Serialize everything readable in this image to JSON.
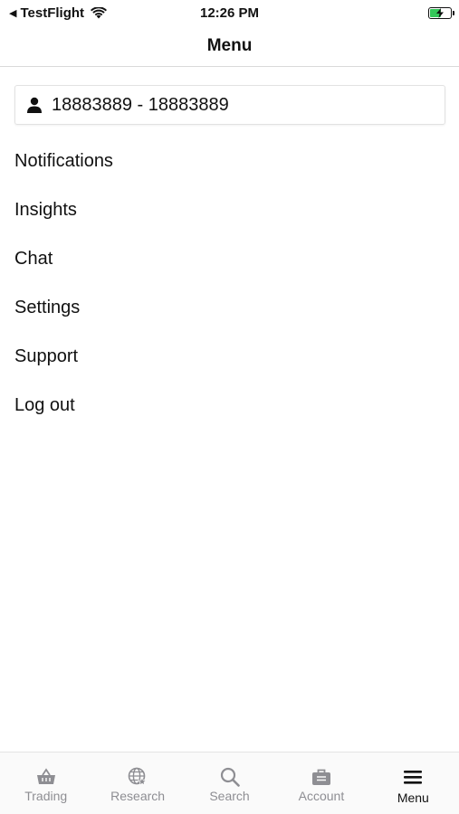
{
  "status_bar": {
    "back_label": "TestFlight",
    "time": "12:26 PM",
    "battery_color": "#34c759"
  },
  "header": {
    "title": "Menu"
  },
  "account": {
    "label": "18883889 - 18883889",
    "icon": "user-icon"
  },
  "menu": {
    "items": [
      {
        "label": "Notifications"
      },
      {
        "label": "Insights"
      },
      {
        "label": "Chat"
      },
      {
        "label": "Settings"
      },
      {
        "label": "Support"
      },
      {
        "label": "Log out"
      }
    ]
  },
  "tabs": [
    {
      "label": "Trading",
      "icon": "basket-icon",
      "active": false
    },
    {
      "label": "Research",
      "icon": "globe-star-icon",
      "active": false
    },
    {
      "label": "Search",
      "icon": "search-icon",
      "active": false
    },
    {
      "label": "Account",
      "icon": "briefcase-icon",
      "active": false
    },
    {
      "label": "Menu",
      "icon": "hamburger-icon",
      "active": true
    }
  ],
  "colors": {
    "inactive_tab": "#8e8e93",
    "active_tab": "#111111"
  }
}
